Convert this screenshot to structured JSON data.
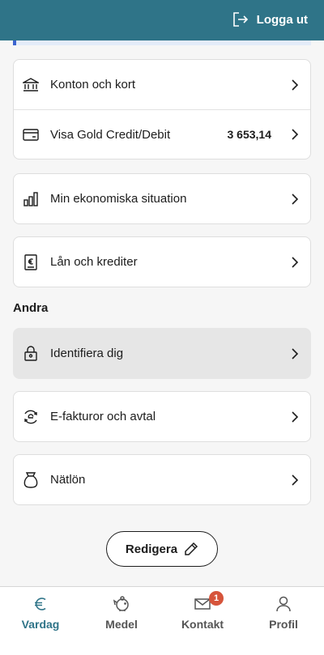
{
  "header": {
    "logout_label": "Logga ut",
    "logout_icon": "logout-icon"
  },
  "cards": {
    "accounts": {
      "label": "Konton och kort",
      "icon": "bank-icon"
    },
    "visa": {
      "label": "Visa Gold Credit/Debit",
      "amount": "3 653,14",
      "icon": "credit-card-icon"
    },
    "economy": {
      "label": "Min ekonomiska situation",
      "icon": "bar-chart-icon"
    },
    "loans": {
      "label": "Lån och krediter",
      "icon": "euro-document-icon"
    }
  },
  "section_other": {
    "title": "Andra"
  },
  "other_items": {
    "identify": {
      "label": "Identifiera dig",
      "icon": "lock-icon"
    },
    "einvoice": {
      "label": "E-fakturor och avtal",
      "icon": "e-invoice-icon"
    },
    "salary": {
      "label": "Nätlön",
      "icon": "money-bag-icon"
    }
  },
  "edit_button": {
    "label": "Redigera",
    "icon": "pencil-icon"
  },
  "bottom_nav": {
    "items": [
      {
        "label": "Vardag",
        "icon": "euro-icon",
        "active": true
      },
      {
        "label": "Medel",
        "icon": "piggy-bank-icon",
        "active": false
      },
      {
        "label": "Kontakt",
        "icon": "mail-icon",
        "active": false,
        "badge": "1"
      },
      {
        "label": "Profil",
        "icon": "user-icon",
        "active": false
      }
    ]
  },
  "colors": {
    "header_bg": "#2f7488",
    "active_nav": "#2f7488",
    "badge": "#d6543b"
  }
}
